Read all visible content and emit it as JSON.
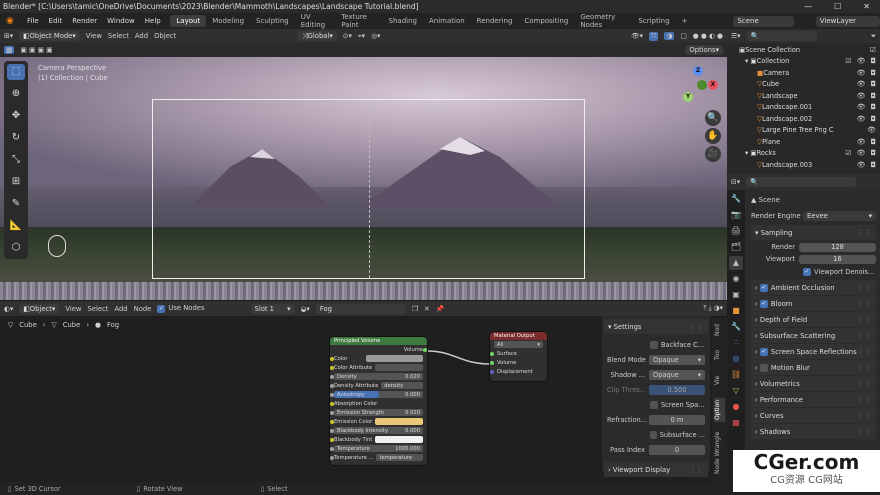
{
  "title_bar": {
    "text": "Blender* [C:\\Users\\tamic\\OneDrive\\Documents\\2023\\Blender\\Mammoth\\Landscapes\\Landscape Tutorial.blend]",
    "minimize": "—",
    "maximize": "☐",
    "close": "✕"
  },
  "menu": [
    "File",
    "Edit",
    "Render",
    "Window",
    "Help"
  ],
  "workspaces": [
    "Layout",
    "Modeling",
    "Sculpting",
    "UV Editing",
    "Texture Paint",
    "Shading",
    "Animation",
    "Rendering",
    "Compositing",
    "Geometry Nodes",
    "Scripting"
  ],
  "active_workspace": "Layout",
  "add_workspace": "+",
  "scene": "Scene",
  "view_layer": "ViewLayer",
  "viewport_header": {
    "mode": "Object Mode",
    "menus": [
      "View",
      "Select",
      "Add",
      "Object"
    ],
    "transform_orientation": "Global",
    "options": "Options"
  },
  "viewport": {
    "overlay_line1": "Camera Perspective",
    "overlay_line2": "(1) Collection | Cube",
    "gizmo": {
      "x": "X",
      "y": "Y",
      "z": "Z"
    }
  },
  "outliner": {
    "search_placeholder": "",
    "items": [
      {
        "label": "Scene Collection"
      },
      {
        "label": "Collection"
      },
      {
        "label": "Camera"
      },
      {
        "label": "Cube"
      },
      {
        "label": "Landscape"
      },
      {
        "label": "Landscape.001"
      },
      {
        "label": "Landscape.002"
      },
      {
        "label": "Large Pine Tree Png C"
      },
      {
        "label": "Plane"
      },
      {
        "label": "Rocks"
      },
      {
        "label": "Landscape.003"
      }
    ]
  },
  "properties": {
    "context": "Scene",
    "render_engine_label": "Render Engine",
    "render_engine": "Eevee",
    "sampling": {
      "title": "Sampling",
      "render_label": "Render",
      "render_value": "128",
      "viewport_label": "Viewport",
      "viewport_value": "16",
      "denoise": "Viewport Denois..."
    },
    "panels": [
      "Ambient Occlusion",
      "Bloom",
      "Depth of Field",
      "Subsurface Scattering",
      "Screen Space Reflections",
      "Motion Blur",
      "Volumetrics",
      "Performance",
      "Curves",
      "Shadows"
    ],
    "panel_checked": {
      "Ambient Occlusion": true,
      "Bloom": true,
      "Screen Space Reflections": true,
      "Motion Blur": false
    }
  },
  "node_header": {
    "type": "Object",
    "menus": [
      "View",
      "Select",
      "Add",
      "Node"
    ],
    "use_nodes": "Use Nodes",
    "slot": "Slot 1",
    "material": "Fog"
  },
  "breadcrumb": [
    "Cube",
    "Cube",
    "Fog"
  ],
  "principled_volume": {
    "title": "Principled Volume",
    "output": "Volume",
    "rows": [
      {
        "label": "Color",
        "value": ""
      },
      {
        "label": "Color Attribute",
        "value": ""
      },
      {
        "label": "Density",
        "value": "0.020"
      },
      {
        "label": "Density Attribute",
        "value": "density"
      },
      {
        "label": "Anisotropy",
        "value": "0.000"
      },
      {
        "label": "Absorption Color",
        "value": ""
      },
      {
        "label": "Emission Strength",
        "value": "0.020"
      },
      {
        "label": "Emission Color",
        "value": ""
      },
      {
        "label": "Blackbody Intensity",
        "value": "0.000"
      },
      {
        "label": "Blackbody Tint",
        "value": ""
      },
      {
        "label": "Temperature",
        "value": "1000.000"
      },
      {
        "label": "Temperature ...",
        "value": "temperature"
      }
    ]
  },
  "material_output": {
    "title": "Material Output",
    "target": "All",
    "sockets": [
      "Surface",
      "Volume",
      "Displacement"
    ]
  },
  "side_settings": {
    "title": "Settings",
    "backface": "Backface C...",
    "blend_mode_label": "Blend Mode",
    "blend_mode": "Opaque",
    "shadow_mode_label": "Shadow ...",
    "shadow_mode": "Opaque",
    "clip_label": "Clip Thres...",
    "clip_value": "0.500",
    "screen_space": "Screen Spa...",
    "refraction_label": "Refraction...",
    "refraction_value": "0 m",
    "subsurface": "Subsurface ...",
    "pass_label": "Pass Index",
    "pass_value": "0",
    "viewport_display": "Viewport Display"
  },
  "side_tabs": [
    "Nod",
    "Too",
    "Vie",
    "Option",
    "Node Wrangle"
  ],
  "status": {
    "left": "Set 3D Cursor",
    "mid": "Rotate View",
    "right": "Select"
  },
  "watermark": {
    "big": "CGer.com",
    "small": "CG资源 CG网站"
  },
  "colors": {
    "accent": "#4772b3",
    "volume_header": "#3e7a3e",
    "output_header": "#7a2b2b",
    "orange": "#e87d0d"
  }
}
